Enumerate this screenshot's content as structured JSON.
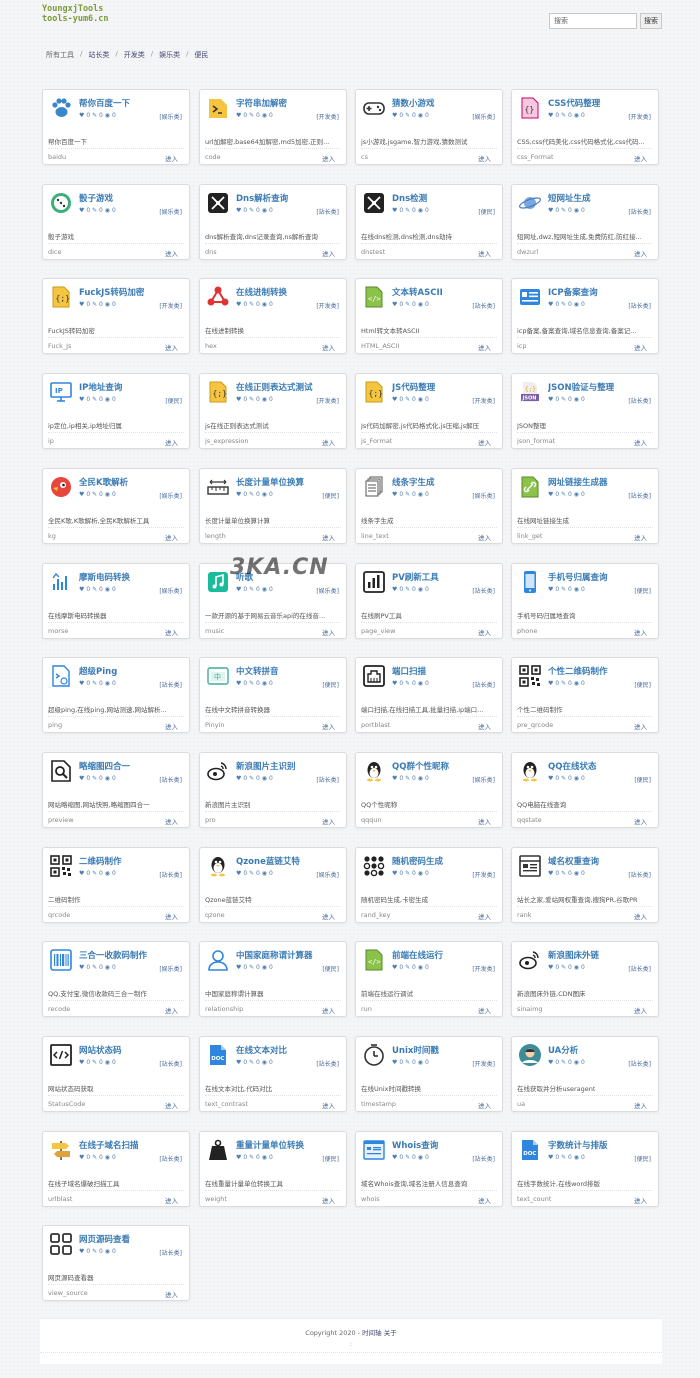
{
  "header": {
    "logo_line1": "YoungxjTools",
    "logo_line2": "tools-yum6.cn",
    "search_placeholder": "搜索",
    "search_button": "搜索"
  },
  "breadcrumb": [
    "所有工具",
    "站长类",
    "开发类",
    "娱乐类",
    "便民"
  ],
  "watermark": "3KA.CN",
  "footer": {
    "copyright": "Copyright 2020 - ",
    "link_timeline": "时间轴",
    "link_about": "关于",
    "colon": ":"
  },
  "tools": [
    {
      "title": "帮你百度一下",
      "category": "[娱乐类]",
      "desc": "帮你百度一下",
      "slug": "baidu",
      "icon": "paw-icon"
    },
    {
      "title": "字符串加解密",
      "category": "[开发类]",
      "desc": "url加解密,base64加解密,md5加密,正则...",
      "slug": "code",
      "icon": "terminal-folder-icon"
    },
    {
      "title": "猜数小游戏",
      "category": "[娱乐类]",
      "desc": "js小游戏,jsgame,智力游戏,猜数测试",
      "slug": "cs",
      "icon": "gamepad-icon"
    },
    {
      "title": "CSS代码整理",
      "category": "[开发类]",
      "desc": "CSS,css代码美化,css代码格式化,css代码...",
      "slug": "css_Format",
      "icon": "css-file-icon"
    },
    {
      "title": "骰子游戏",
      "category": "[娱乐类]",
      "desc": "骰子游戏",
      "slug": "dice",
      "icon": "dice-icon"
    },
    {
      "title": "Dns解析查询",
      "category": "[站长类]",
      "desc": "dns解析查询,dns记录查询,ns解析查询",
      "slug": "dns",
      "icon": "dns-icon"
    },
    {
      "title": "Dns检测",
      "category": "[便民]",
      "desc": "在线dns检测,dns检测,dns劫持",
      "slug": "dnstest",
      "icon": "dns-check-icon"
    },
    {
      "title": "短网址生成",
      "category": "[站长类]",
      "desc": "短网址,dwz,短网址生成,免费防红,防红接...",
      "slug": "dwzurl",
      "icon": "planet-icon"
    },
    {
      "title": "FuckJS转码加密",
      "category": "[开发类]",
      "desc": "FuckJS转码加密",
      "slug": "Fuck_Js",
      "icon": "js-folder-icon"
    },
    {
      "title": "在线进制转换",
      "category": "[开发类]",
      "desc": "在线进制转换",
      "slug": "hex",
      "icon": "network-nodes-icon"
    },
    {
      "title": "文本转ASCII",
      "category": "[站长类]",
      "desc": "Html转文本转ASCII",
      "slug": "HTML_ASCII",
      "icon": "code-file-icon"
    },
    {
      "title": "ICP备案查询",
      "category": "[站长类]",
      "desc": "icp备案,备案查询,域名信息查询,备案记...",
      "slug": "icp",
      "icon": "id-card-icon"
    },
    {
      "title": "IP地址查询",
      "category": "[便民]",
      "desc": "ip定位,ip相关,ip地址归属",
      "slug": "ip",
      "icon": "ip-monitor-icon"
    },
    {
      "title": "在线正则表达式测试",
      "category": "[开发类]",
      "desc": "js在线正则表达式测试",
      "slug": "js_expression",
      "icon": "regex-folder-icon"
    },
    {
      "title": "JS代码整理",
      "category": "[开发类]",
      "desc": "Js代码加解密,js代码格式化,js压缩,js解压",
      "slug": "js_Format",
      "icon": "js-code-icon"
    },
    {
      "title": "JSON验证与整理",
      "category": "[站长类]",
      "desc": "JSON整理",
      "slug": "json_format",
      "icon": "json-icon"
    },
    {
      "title": "全民K歌解析",
      "category": "[娱乐类]",
      "desc": "全民K歌,K歌解析,全民K歌解析工具",
      "slug": "kg",
      "icon": "bird-icon"
    },
    {
      "title": "长度计量单位换算",
      "category": "[便民]",
      "desc": "长度计量单位换算计算",
      "slug": "length",
      "icon": "ruler-icon"
    },
    {
      "title": "线条字生成",
      "category": "[娱乐类]",
      "desc": "线条字生成",
      "slug": "line_text",
      "icon": "pages-icon"
    },
    {
      "title": "网址链接生成器",
      "category": "[站长类]",
      "desc": "在线网址链接生成",
      "slug": "link_get",
      "icon": "link-file-icon"
    },
    {
      "title": "摩斯电码转换",
      "category": "[娱乐类]",
      "desc": "在线摩斯电码转换器",
      "slug": "morse",
      "icon": "morse-icon"
    },
    {
      "title": "听歌",
      "category": "[娱乐类]",
      "desc": "一款开源的基于网易云音乐api的在线音...",
      "slug": "music",
      "icon": "music-icon"
    },
    {
      "title": "PV刷新工具",
      "category": "[站长类]",
      "desc": "在线刷PV工具",
      "slug": "page_view",
      "icon": "bar-chart-icon"
    },
    {
      "title": "手机号归属查询",
      "category": "[便民]",
      "desc": "手机号码归属地查询",
      "slug": "phone",
      "icon": "phone-icon"
    },
    {
      "title": "超级Ping",
      "category": "[站长类]",
      "desc": "超级ping,在线ping,网站测速,网站解析...",
      "slug": "ping",
      "icon": "terminal-file-icon"
    },
    {
      "title": "中文转拼音",
      "category": "[便民]",
      "desc": "在线中文转拼音转换器",
      "slug": "Pinyin",
      "icon": "pinyin-icon"
    },
    {
      "title": "端口扫描",
      "category": "[站长类]",
      "desc": "端口扫描,在线扫描工具,批量扫描,ip端口...",
      "slug": "portblast",
      "icon": "ethernet-icon"
    },
    {
      "title": "个性二维码制作",
      "category": "[便民]",
      "desc": "个性二维码制作",
      "slug": "pre_qrcode",
      "icon": "qr-icon"
    },
    {
      "title": "略缩图四合一",
      "category": "[站长类]",
      "desc": "网站略缩图,网站快照,略缩图四合一",
      "slug": "preview",
      "icon": "magnifier-file-icon"
    },
    {
      "title": "新浪图片主识别",
      "category": "[站长类]",
      "desc": "新浪图片主识别",
      "slug": "pro",
      "icon": "weibo-icon"
    },
    {
      "title": "QQ群个性昵称",
      "category": "[娱乐类]",
      "desc": "QQ个性昵称",
      "slug": "qqqun",
      "icon": "penguin-icon"
    },
    {
      "title": "QQ在线状态",
      "category": "[便民]",
      "desc": "QQ电脑在线查询",
      "slug": "qqstate",
      "icon": "penguin-icon"
    },
    {
      "title": "二维码制作",
      "category": "[站长类]",
      "desc": "二维码制作",
      "slug": "qrcode",
      "icon": "qr-icon"
    },
    {
      "title": "Qzone蓝链艾特",
      "category": "[娱乐类]",
      "desc": "Qzone蓝链艾特",
      "slug": "qzone",
      "icon": "penguin-icon"
    },
    {
      "title": "随机密码生成",
      "category": "[开发类]",
      "desc": "随机密码生成,卡密生成",
      "slug": "rand_key",
      "icon": "keypad-icon"
    },
    {
      "title": "域名权重查询",
      "category": "[站长类]",
      "desc": "站长之家,爱站网权重查询,搜狗PR,谷歌PR",
      "slug": "rank",
      "icon": "browser-grid-icon"
    },
    {
      "title": "三合一收款码制作",
      "category": "[娱乐类]",
      "desc": "QQ,支付宝,微信收款码三合一制作",
      "slug": "recode",
      "icon": "barcode-icon"
    },
    {
      "title": "中国家庭称谓计算器",
      "category": "[便民]",
      "desc": "中国家庭称谓计算器",
      "slug": "relationship",
      "icon": "user-outline-icon"
    },
    {
      "title": "前端在线运行",
      "category": "[开发类]",
      "desc": "前端在线运行调试",
      "slug": "run",
      "icon": "code-file-icon"
    },
    {
      "title": "新浪图床外链",
      "category": "[站长类]",
      "desc": "新浪图床外链,CDN图床",
      "slug": "sinaimg",
      "icon": "weibo-icon"
    },
    {
      "title": "网站状态码",
      "category": "[站长类]",
      "desc": "网站状态码获取",
      "slug": "StatusCode",
      "icon": "code-page-icon"
    },
    {
      "title": "在线文本对比",
      "category": "[站长类]",
      "desc": "在线文本对比,代码对比",
      "slug": "text_contrast",
      "icon": "doc-icon"
    },
    {
      "title": "Unix时间戳",
      "category": "[开发类]",
      "desc": "在线Unix时间戳转换",
      "slug": "timestamp",
      "icon": "clock-icon"
    },
    {
      "title": "UA分析",
      "category": "[站长类]",
      "desc": "在线获取并分析useragent",
      "slug": "ua",
      "icon": "avatar-icon"
    },
    {
      "title": "在线子域名扫描",
      "category": "[站长类]",
      "desc": "在线子域名爆破扫描工具",
      "slug": "urlblast",
      "icon": "signpost-icon"
    },
    {
      "title": "重量计量单位转换",
      "category": "[便民]",
      "desc": "在线重量计量单位转换工具",
      "slug": "weight",
      "icon": "weight-icon"
    },
    {
      "title": "Whois查询",
      "category": "[站长类]",
      "desc": "域名Whois查询,域名注册人信息查询",
      "slug": "whois",
      "icon": "window-list-icon"
    },
    {
      "title": "字数统计与排版",
      "category": "[便民]",
      "desc": "在线字数统计,在线word排版",
      "slug": "text_count",
      "icon": "doc-icon"
    },
    {
      "title": "网页源码查看",
      "category": "[站长类]",
      "desc": "网页源码查看器",
      "slug": "view_source",
      "icon": "four-squares-icon"
    }
  ],
  "card_meta": {
    "likes": "0",
    "comments": "0",
    "views": "0",
    "enter_label": "进入"
  }
}
